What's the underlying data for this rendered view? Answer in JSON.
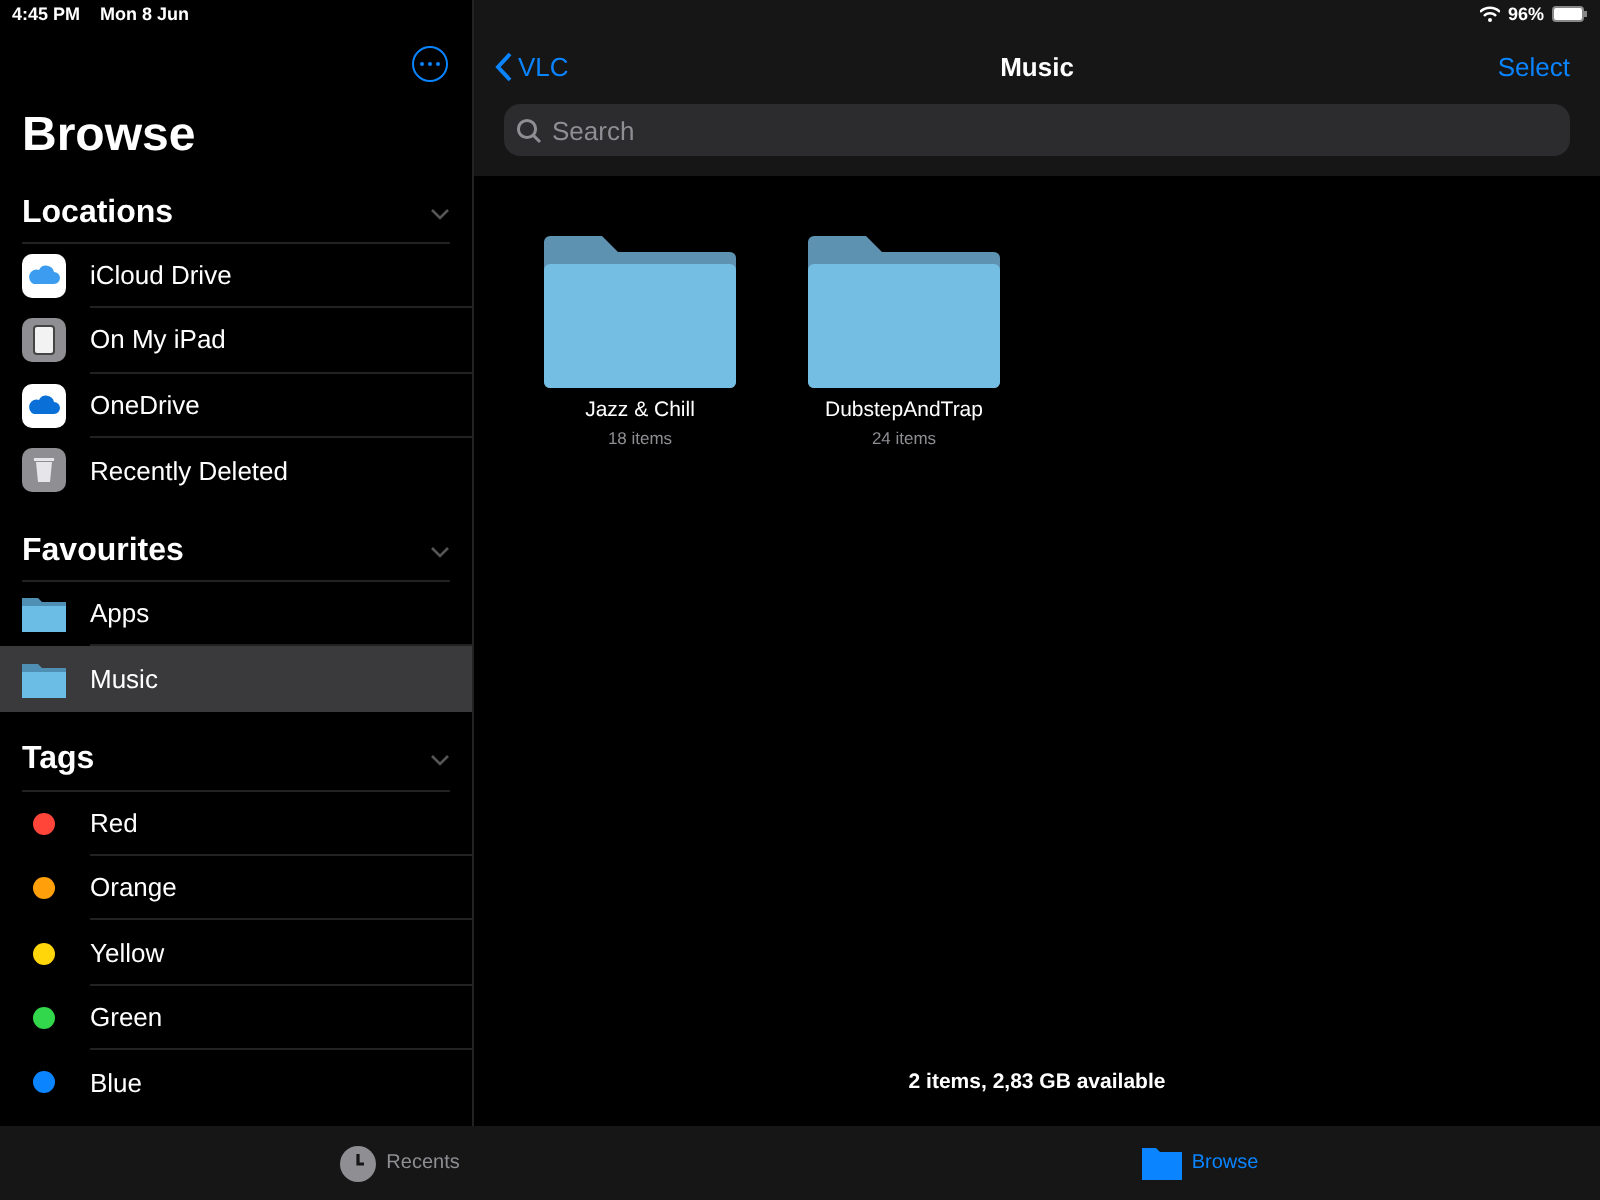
{
  "status_bar": {
    "time": "4:45 PM",
    "date": "Mon 8 Jun",
    "battery": "96%"
  },
  "sidebar": {
    "title": "Browse",
    "sections": [
      {
        "title": "Locations",
        "expanded": true,
        "items": [
          {
            "kind": "icloud",
            "label": "iCloud Drive",
            "selected": false
          },
          {
            "kind": "ipad",
            "label": "On My iPad",
            "selected": false
          },
          {
            "kind": "onedrive",
            "label": "OneDrive",
            "selected": false
          },
          {
            "kind": "trash",
            "label": "Recently Deleted",
            "selected": false
          }
        ]
      },
      {
        "title": "Favourites",
        "expanded": true,
        "items": [
          {
            "kind": "folder",
            "label": "Apps",
            "selected": false
          },
          {
            "kind": "folder",
            "label": "Music",
            "selected": true
          }
        ]
      },
      {
        "title": "Tags",
        "expanded": true,
        "items": [
          {
            "kind": "tag",
            "label": "Red",
            "color": "#ff453a",
            "selected": false
          },
          {
            "kind": "tag",
            "label": "Orange",
            "color": "#ff9f0a",
            "selected": false
          },
          {
            "kind": "tag",
            "label": "Yellow",
            "color": "#ffd60a",
            "selected": false
          },
          {
            "kind": "tag",
            "label": "Green",
            "color": "#32d74b",
            "selected": false
          },
          {
            "kind": "tag",
            "label": "Blue",
            "color": "#0a84ff",
            "selected": false
          }
        ]
      }
    ]
  },
  "nav": {
    "back": "VLC",
    "title": "Music",
    "action": "Select"
  },
  "search": {
    "placeholder": "Search"
  },
  "folders": [
    {
      "name": "Jazz & Chill",
      "count": "18 items"
    },
    {
      "name": "DubstepAndTrap",
      "count": "24 items"
    }
  ],
  "footer": "2 items, 2,83 GB available",
  "tabs": [
    {
      "kind": "recents",
      "label": "Recents",
      "selected": false
    },
    {
      "kind": "browse",
      "label": "Browse",
      "selected": true
    }
  ]
}
